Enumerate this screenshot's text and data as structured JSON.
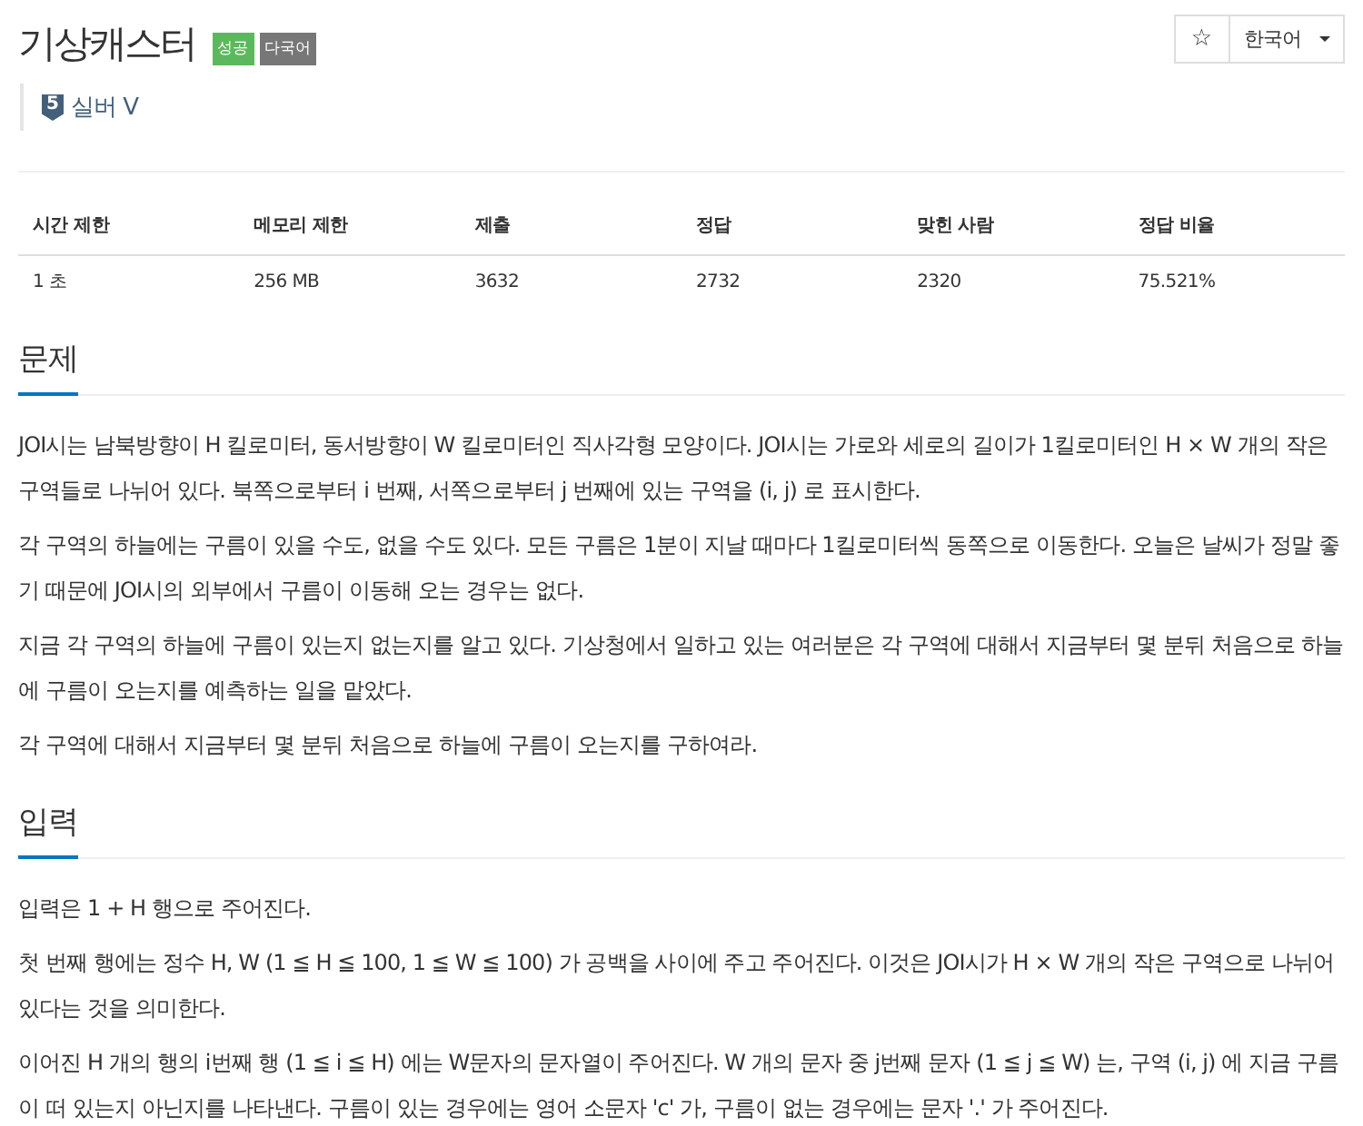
{
  "title": "기상캐스터",
  "badges": [
    {
      "label": "성공",
      "kind": "success"
    },
    {
      "label": "다국어",
      "kind": "multilang"
    }
  ],
  "tier": {
    "number": "5",
    "label": "실버 V"
  },
  "toolbar": {
    "star": "☆",
    "language": "한국어"
  },
  "stats": {
    "columns": [
      "시간 제한",
      "메모리 제한",
      "제출",
      "정답",
      "맞힌 사람",
      "정답 비율"
    ],
    "rows": [
      [
        "1 초",
        "256 MB",
        "3632",
        "2732",
        "2320",
        "75.521%"
      ]
    ]
  },
  "sections": [
    {
      "heading": "문제",
      "paragraphs": [
        "JOI시는 남북방향이 H 킬로미터, 동서방향이 W 킬로미터인 직사각형 모양이다. JOI시는 가로와 세로의 길이가 1킬로미터인 H × W 개의 작은 구역들로 나뉘어 있다. 북쪽으로부터 i 번째, 서쪽으로부터 j 번째에 있는 구역을 (i, j) 로 표시한다.",
        "각 구역의 하늘에는 구름이 있을 수도, 없을 수도 있다. 모든 구름은 1분이 지날 때마다 1킬로미터씩 동쪽으로 이동한다. 오늘은 날씨가 정말 좋기 때문에 JOI시의 외부에서 구름이 이동해 오는 경우는 없다.",
        "지금 각 구역의 하늘에 구름이 있는지 없는지를 알고 있다. 기상청에서 일하고 있는 여러분은 각 구역에 대해서 지금부터 몇 분뒤 처음으로 하늘에 구름이 오는지를 예측하는 일을 맡았다.",
        "각 구역에 대해서 지금부터 몇 분뒤 처음으로 하늘에 구름이 오는지를 구하여라."
      ]
    },
    {
      "heading": "입력",
      "paragraphs": [
        "입력은 1 + H 행으로 주어진다.",
        "첫 번째 행에는 정수 H, W (1 ≦ H ≦ 100, 1 ≦ W ≦ 100) 가 공백을 사이에 주고 주어진다. 이것은 JOI시가 H × W 개의 작은 구역으로 나뉘어 있다는 것을 의미한다.",
        "이어진 H 개의 행의 i번째 행 (1 ≦ i ≦ H) 에는 W문자의 문자열이 주어진다. W 개의 문자 중 j번째 문자 (1 ≦ j ≦ W) 는, 구역 (i, j) 에 지금 구름이 떠 있는지 아닌지를 나타낸다. 구름이 있는 경우에는 영어 소문자 'c' 가, 구름이 없는 경우에는 문자 '.' 가 주어진다."
      ]
    }
  ]
}
